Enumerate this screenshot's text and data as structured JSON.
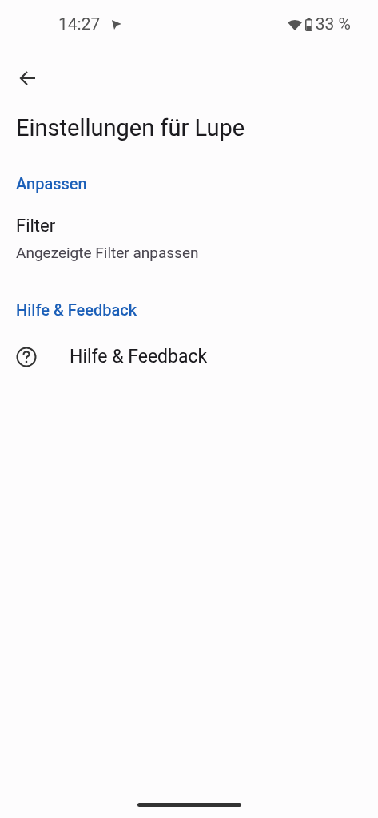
{
  "status_bar": {
    "time": "14:27",
    "battery": "33 %"
  },
  "app_bar": {
    "title": "Einstellungen für Lupe"
  },
  "sections": [
    {
      "header": "Anpassen",
      "items": [
        {
          "kind": "plain",
          "title": "Filter",
          "summary": "Angezeigte Filter anpassen"
        }
      ]
    },
    {
      "header": "Hilfe & Feedback",
      "items": [
        {
          "kind": "help",
          "title": "Hilfe & Feedback"
        }
      ]
    }
  ]
}
